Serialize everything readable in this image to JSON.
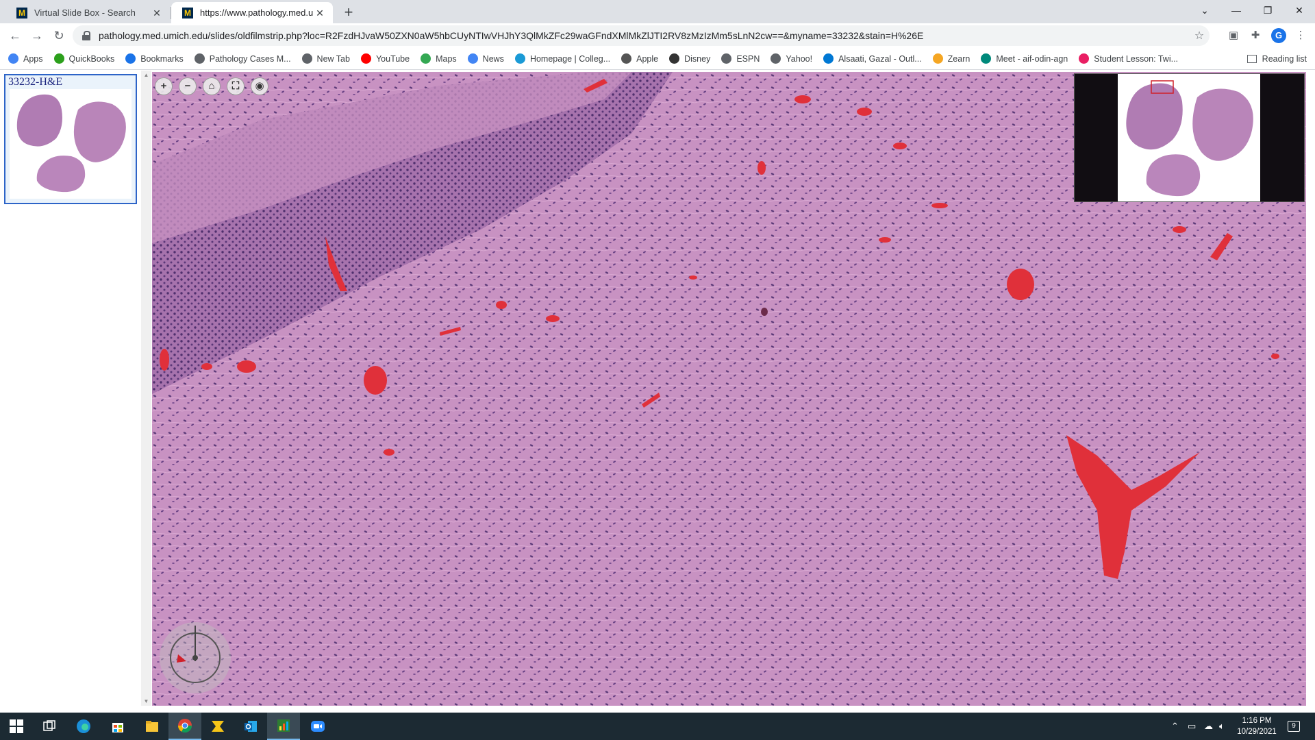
{
  "browser": {
    "tabs": [
      {
        "title": "Virtual Slide Box - Search",
        "favicon": "M",
        "active": false
      },
      {
        "title": "https://www.pathology.med.umi",
        "favicon": "M",
        "active": true
      }
    ],
    "url": "pathology.med.umich.edu/slides/oldfilmstrip.php?loc=R2FzdHJvaW50ZXN0aW5hbCUyNTIwVHJhY3QlMkZFc29waGFndXMlMkZlJTI2RV8zMzIzMm5sLnN2cw==&myname=33232&stain=H%26E",
    "reading_list": "Reading list",
    "profile_initial": "G",
    "bookmarks": [
      {
        "label": "Apps",
        "icon": "apps-grid-icon",
        "color": "#4285f4"
      },
      {
        "label": "QuickBooks",
        "icon": "quickbooks-icon",
        "color": "#2ca01c"
      },
      {
        "label": "Bookmarks",
        "icon": "star-icon",
        "color": "#1a73e8"
      },
      {
        "label": "Pathology Cases M...",
        "icon": "globe-icon",
        "color": "#5f6368"
      },
      {
        "label": "New Tab",
        "icon": "globe-icon",
        "color": "#5f6368"
      },
      {
        "label": "YouTube",
        "icon": "youtube-icon",
        "color": "#ff0000"
      },
      {
        "label": "Maps",
        "icon": "maps-pin-icon",
        "color": "#34a853"
      },
      {
        "label": "News",
        "icon": "news-icon",
        "color": "#4285f4"
      },
      {
        "label": "Homepage | Colleg...",
        "icon": "college-icon",
        "color": "#1a9ad6"
      },
      {
        "label": "Apple",
        "icon": "apple-icon",
        "color": "#555555"
      },
      {
        "label": "Disney",
        "icon": "disney-icon",
        "color": "#333333"
      },
      {
        "label": "ESPN",
        "icon": "globe-icon",
        "color": "#5f6368"
      },
      {
        "label": "Yahoo!",
        "icon": "globe-icon",
        "color": "#5f6368"
      },
      {
        "label": "Alsaati, Gazal - Outl...",
        "icon": "outlook-icon",
        "color": "#0078d4"
      },
      {
        "label": "Zearn",
        "icon": "zearn-icon",
        "color": "#f5a623"
      },
      {
        "label": "Meet - aif-odin-agn",
        "icon": "meet-icon",
        "color": "#00897b"
      },
      {
        "label": "Student Lesson: Twi...",
        "icon": "lesson-icon",
        "color": "#e91e63"
      }
    ]
  },
  "viewer": {
    "slide_label": "33232-H&E",
    "controls": [
      {
        "name": "zoom-in-button",
        "glyph": "+"
      },
      {
        "name": "zoom-out-button",
        "glyph": "−"
      },
      {
        "name": "home-button",
        "glyph": "⌂"
      },
      {
        "name": "fullscreen-button",
        "glyph": "⛶"
      },
      {
        "name": "snapshot-button",
        "glyph": "◉"
      }
    ],
    "colors": {
      "tissue": "#c78fc0",
      "vessel": "#e0303a",
      "epithelium": "#9b62a6"
    }
  },
  "taskbar": {
    "time": "1:16 PM",
    "date": "10/29/2021",
    "notifications": "9"
  }
}
